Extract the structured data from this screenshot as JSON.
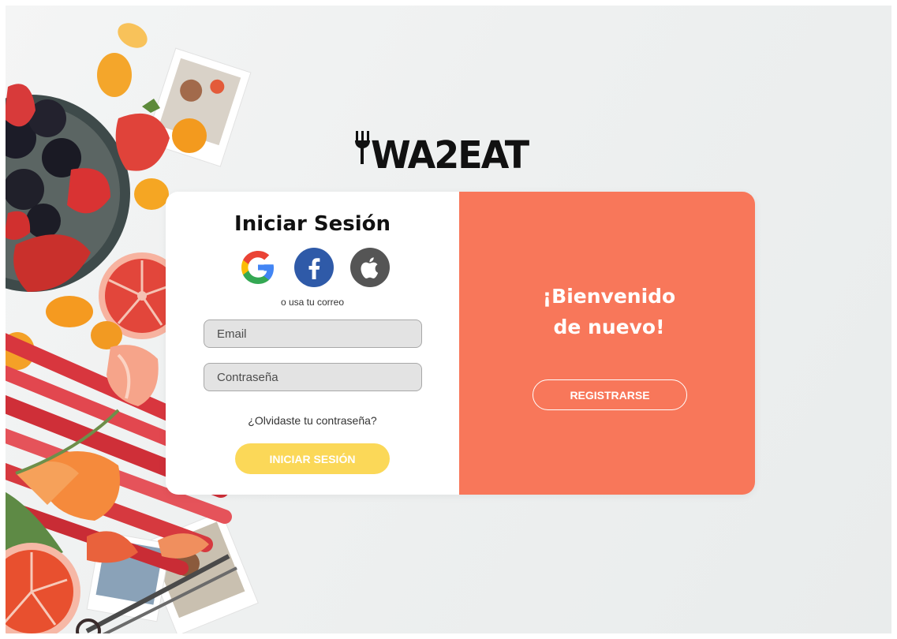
{
  "brand": {
    "logo_text": "WA2EAT",
    "icon": "fork-icon"
  },
  "login": {
    "title": "Iniciar Sesión",
    "social": [
      {
        "name": "google",
        "icon": "google-icon",
        "color": "#4285F4"
      },
      {
        "name": "facebook",
        "icon": "facebook-icon",
        "color": "#2f5aa8"
      },
      {
        "name": "apple",
        "icon": "apple-icon",
        "color": "#555555"
      }
    ],
    "divider_text": "o usa tu correo",
    "email_placeholder": "Email",
    "password_placeholder": "Contraseña",
    "forgot_password": "¿Olvidaste tu contraseña?",
    "submit_label": "INICIAR SESIÓN"
  },
  "welcome": {
    "line1": "¡Bienvenido",
    "line2": "de nuevo!",
    "register_label": "REGISTRARSE"
  },
  "colors": {
    "accent": "#f8775a",
    "submit": "#fbd858",
    "panel": "#ffffff",
    "input_bg": "#e3e3e3"
  }
}
